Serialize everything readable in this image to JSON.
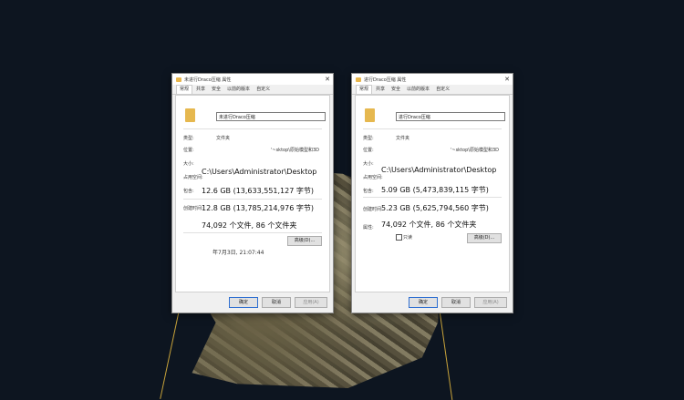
{
  "window_left": {
    "title": "未进行Draco压缩 属性",
    "tabs": [
      "常规",
      "共享",
      "安全",
      "以前的版本",
      "自定义"
    ],
    "name": "未进行Draco压缩",
    "type_label": "类型:",
    "type_value": "文件夹",
    "location_label": "位置:",
    "location_value": "'~sktop\\原始模型和3D",
    "size_label": "大小:",
    "size_on_disk_label": "占用空间:",
    "contains_label": "包含:",
    "created_label": "创建时间:",
    "path": "C:\\Users\\Administrator\\Desktop",
    "size_value": "12.6 GB (13,633,551,127 字节)",
    "size_on_disk_value": "12.8 GB (13,785,214,976 字节)",
    "contains_value": "74,092 个文件, 86 个文件夹",
    "created_value": "年7月3日, 21:07:44",
    "advanced_button": "高级(D)...",
    "ok": "确定",
    "cancel": "取消",
    "apply": "应用(A)"
  },
  "window_right": {
    "title": "进行Draco压缩 属性",
    "tabs": [
      "常规",
      "共享",
      "安全",
      "以前的版本",
      "自定义"
    ],
    "name": "进行Draco压缩",
    "type_label": "类型:",
    "type_value": "文件夹",
    "location_label": "位置:",
    "location_value": "'~sktop\\原始模型和3D",
    "size_label": "大小:",
    "size_on_disk_label": "占用空间:",
    "contains_label": "包含:",
    "created_label": "创建时间:",
    "attr_label": "属性:",
    "path": "C:\\Users\\Administrator\\Desktop",
    "size_value": "5.09 GB (5,473,839,115 字节)",
    "size_on_disk_value": "5.23 GB (5,625,794,560 字节)",
    "contains_value": "74,092 个文件, 86 个文件夹",
    "readonly_label": "只读",
    "advanced_button": "高级(D)...",
    "ok": "确定",
    "cancel": "取消",
    "apply": "应用(A)"
  }
}
